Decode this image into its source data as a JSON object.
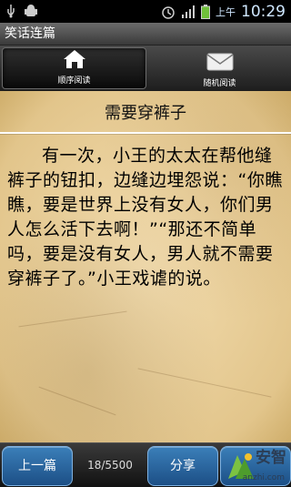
{
  "status_bar": {
    "ampm": "上午",
    "time": "10:29",
    "icons": [
      "usb-icon",
      "android-debug-icon",
      "alarm-icon",
      "signal-icon",
      "battery-icon"
    ]
  },
  "app": {
    "title": "笑话连篇"
  },
  "tabs": [
    {
      "label": "顺序阅读",
      "icon": "home-icon",
      "active": true
    },
    {
      "label": "随机阅读",
      "icon": "mail-icon",
      "active": false
    }
  ],
  "article": {
    "title": "需要穿裤子",
    "body": "有一次，小王的太太在帮他缝裤子的钮扣，边缝边埋怨说：“你瞧瞧，要是世界上没有女人，你们男人怎么活下去啊！”“那还不简单吗，要是没有女人，男人就不需要穿裤子了。”小王戏谑的说。"
  },
  "footer": {
    "prev_label": "上一篇",
    "page_count": "18/5500",
    "share_label": "分享",
    "logo_text": "安智",
    "logo_sub": "anzhi.com"
  },
  "colors": {
    "button_blue": "#2a66a3",
    "clock_blue": "#cfe7ff"
  }
}
